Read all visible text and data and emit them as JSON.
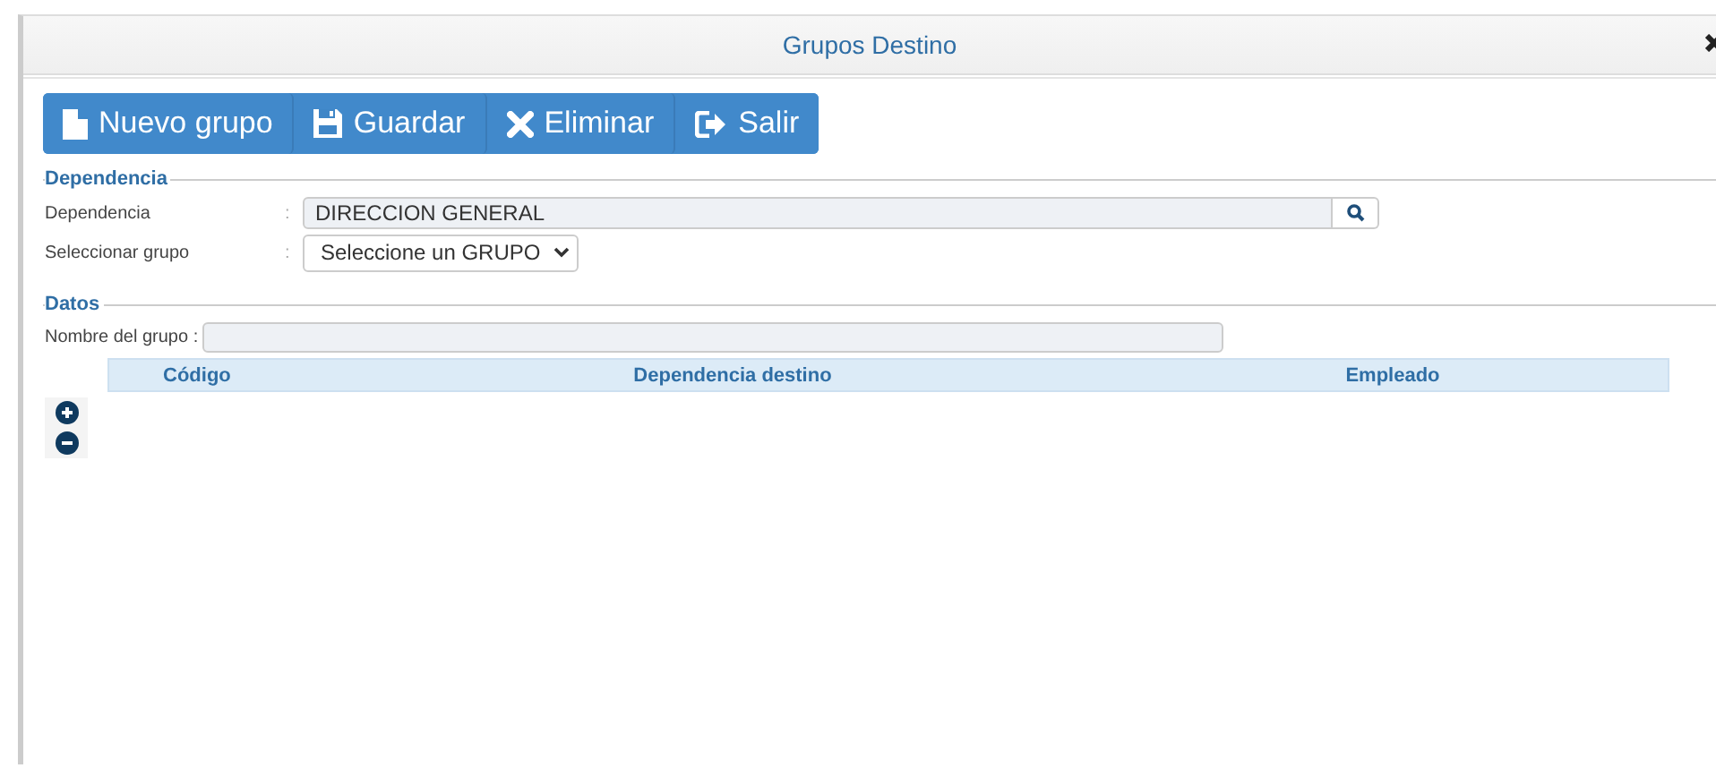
{
  "window": {
    "title": "Grupos Destino"
  },
  "toolbar": [
    {
      "kind": "new",
      "label": "Nuevo grupo"
    },
    {
      "kind": "save",
      "label": "Guardar"
    },
    {
      "kind": "delete",
      "label": "Eliminar"
    },
    {
      "kind": "exit",
      "label": "Salir"
    }
  ],
  "dependencia": {
    "legend": "Dependencia",
    "fields": [
      {
        "kind": "search",
        "label": "Dependencia",
        "separator": ":",
        "value": "DIRECCION GENERAL"
      },
      {
        "kind": "select",
        "label": "Seleccionar grupo",
        "separator": ":",
        "value": "Seleccione un GRUPO"
      }
    ]
  },
  "datos": {
    "legend": "Datos",
    "name_label": "Nombre del grupo :",
    "table": {
      "columns": [
        "Código",
        "Dependencia destino",
        "Empleado"
      ]
    }
  }
}
